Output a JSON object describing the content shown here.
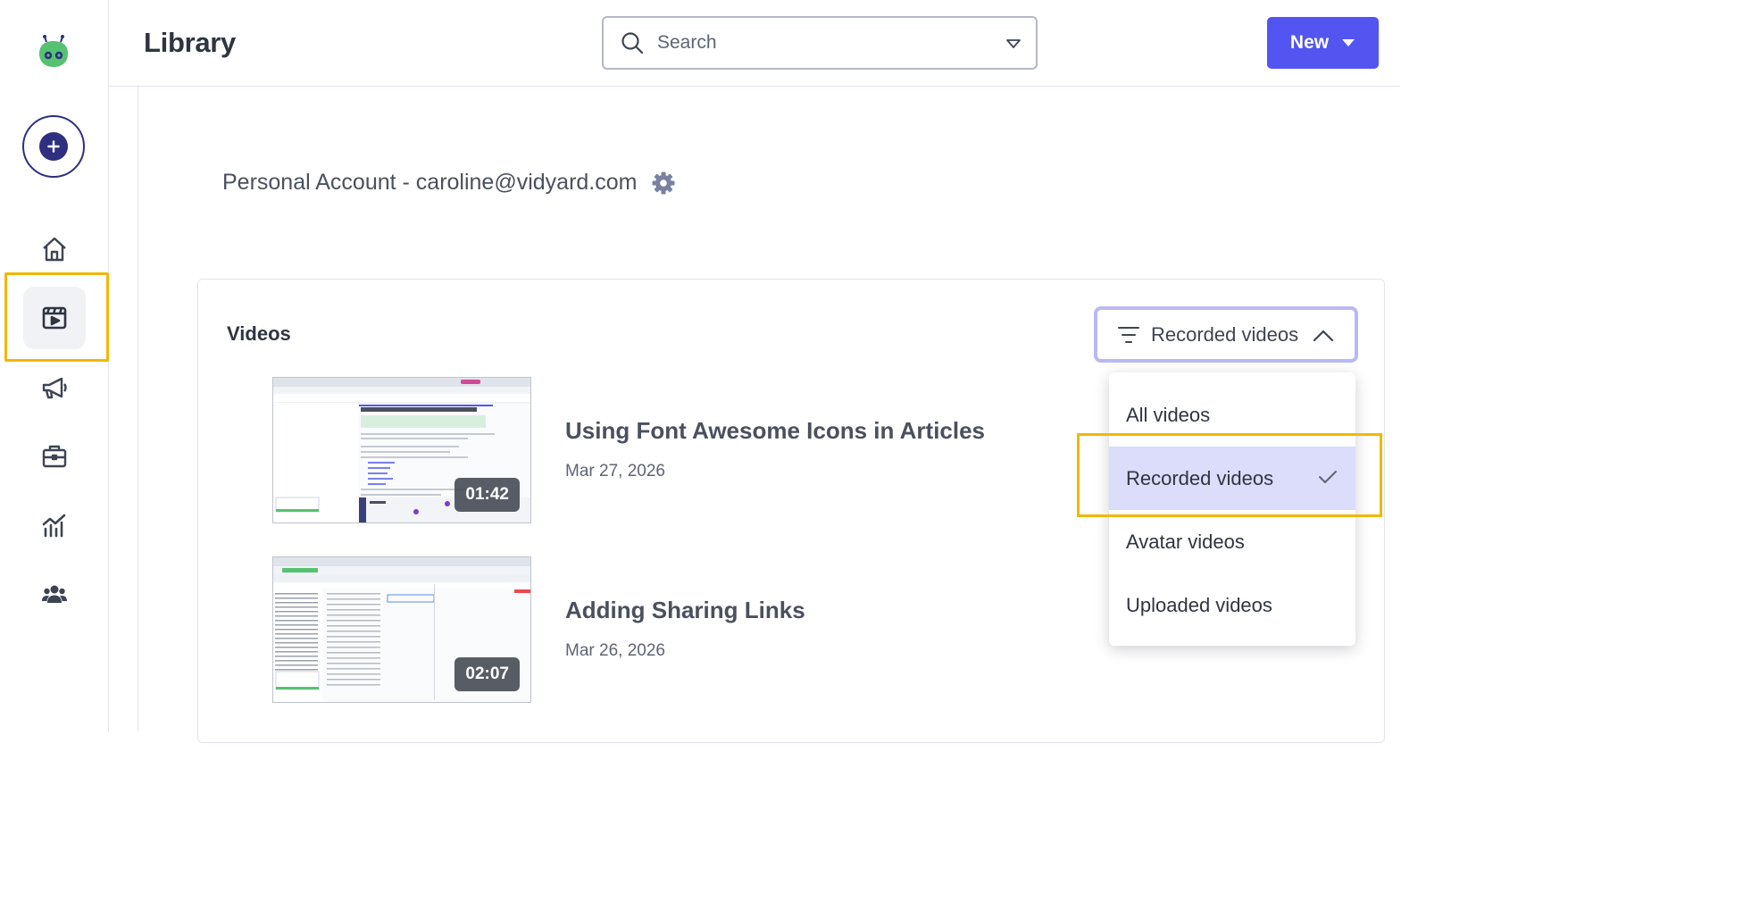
{
  "header": {
    "title": "Library",
    "search_placeholder": "Search",
    "new_label": "New"
  },
  "sidebar": {
    "items": [
      {
        "name": "home",
        "icon": "home-icon"
      },
      {
        "name": "library",
        "icon": "video-library-icon",
        "active": true
      },
      {
        "name": "campaigns",
        "icon": "megaphone-icon"
      },
      {
        "name": "briefcase",
        "icon": "briefcase-icon"
      },
      {
        "name": "analytics",
        "icon": "analytics-icon"
      },
      {
        "name": "team",
        "icon": "team-icon"
      }
    ]
  },
  "account": {
    "label": "Personal Account - caroline@vidyard.com"
  },
  "videos": {
    "heading": "Videos",
    "items": [
      {
        "title": "Using Font Awesome Icons in Articles",
        "date": "Mar 27, 2026",
        "duration": "01:42"
      },
      {
        "title": "Adding Sharing Links",
        "date": "Mar 26, 2026",
        "duration": "02:07"
      }
    ]
  },
  "filter": {
    "selected": "Recorded videos",
    "options": [
      "All videos",
      "Recorded videos",
      "Avatar videos",
      "Uploaded videos"
    ]
  },
  "colors": {
    "accent": "#5255f0",
    "brand_navy": "#2e2f7f",
    "highlight": "#f2b705",
    "selected_bg": "#dcdcfb"
  }
}
